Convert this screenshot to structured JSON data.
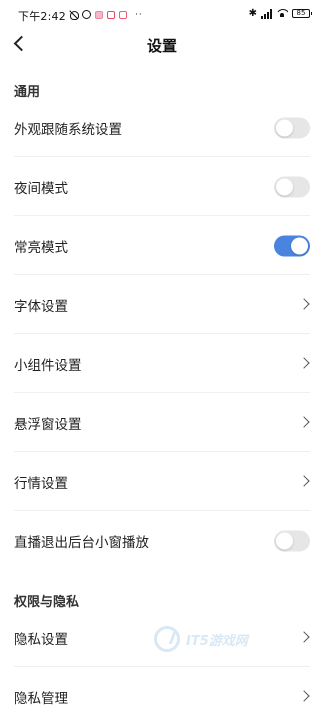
{
  "status_bar": {
    "time": "下午2:42",
    "dots": "··",
    "battery": "85"
  },
  "header": {
    "title": "设置"
  },
  "sections": [
    {
      "title": "通用",
      "rows": [
        {
          "label": "外观跟随系统设置",
          "control": "toggle",
          "on": false
        },
        {
          "label": "夜间模式",
          "control": "toggle",
          "on": false
        },
        {
          "label": "常亮模式",
          "control": "toggle",
          "on": true
        },
        {
          "label": "字体设置",
          "control": "chevron"
        },
        {
          "label": "小组件设置",
          "control": "chevron"
        },
        {
          "label": "悬浮窗设置",
          "control": "chevron"
        },
        {
          "label": "行情设置",
          "control": "chevron"
        },
        {
          "label": "直播退出后台小窗播放",
          "control": "toggle",
          "on": false
        }
      ]
    },
    {
      "title": "权限与隐私",
      "rows": [
        {
          "label": "隐私设置",
          "control": "chevron"
        },
        {
          "label": "隐私管理",
          "control": "chevron"
        }
      ]
    }
  ],
  "watermark": {
    "text": "IT5游戏网"
  },
  "colors": {
    "accent": "#4b84de",
    "toggle_off": "#e6e6e6",
    "divider": "#efefef"
  }
}
